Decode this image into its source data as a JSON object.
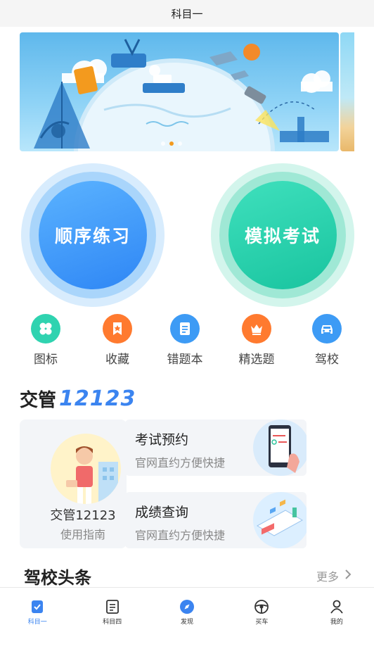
{
  "header": {
    "title": "科目一"
  },
  "banner": {
    "slide_count": 3,
    "active_index": 1,
    "colors": {
      "active_dot": "#f39a1e"
    }
  },
  "practice": {
    "sequential_label": "顺序练习",
    "mock_label": "模拟考试"
  },
  "quick_links": [
    {
      "label": "图标",
      "icon": "grid-icon",
      "color": "#2fd3b0"
    },
    {
      "label": "收藏",
      "icon": "bookmark-star-icon",
      "color": "#ff7a2f"
    },
    {
      "label": "错题本",
      "icon": "notebook-icon",
      "color": "#3d9bf5"
    },
    {
      "label": "精选题",
      "icon": "crown-icon",
      "color": "#ff7a2f"
    },
    {
      "label": "驾校",
      "icon": "car-icon",
      "color": "#3d9bf5"
    }
  ],
  "jiaoguan": {
    "title_prefix": "交管",
    "title_number": "12123",
    "guide": {
      "title": "交管12123",
      "subtitle": "使用指南"
    },
    "services": [
      {
        "title": "考试预约",
        "subtitle": "官网直约方便快捷",
        "icon": "phone-calendar-icon"
      },
      {
        "title": "成绩查询",
        "subtitle": "官网直约方便快捷",
        "icon": "score-report-icon"
      }
    ]
  },
  "news": {
    "title": "驾校头条",
    "more_label": "更多"
  },
  "tabbar": {
    "active_index": 0,
    "items": [
      {
        "label": "科目一",
        "icon": "checklist-icon"
      },
      {
        "label": "科目四",
        "icon": "document-icon"
      },
      {
        "label": "发现",
        "icon": "compass-icon"
      },
      {
        "label": "买车",
        "icon": "steering-wheel-icon"
      },
      {
        "label": "我的",
        "icon": "user-icon"
      }
    ]
  },
  "colors": {
    "accent_blue": "#3b84f0",
    "accent_green": "#19c49f"
  }
}
